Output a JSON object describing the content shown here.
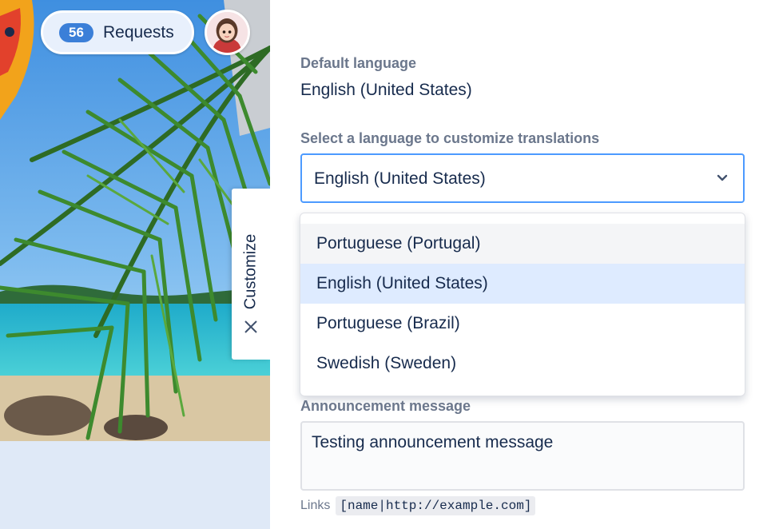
{
  "header": {
    "requests_count": "56",
    "requests_label": "Requests"
  },
  "customize_tab": {
    "label": "Customize",
    "close_icon": "close-icon"
  },
  "form": {
    "default_language_label": "Default language",
    "default_language_value": "English (United States)",
    "select_language_label": "Select a language to customize translations",
    "select_language_value": "English (United States)",
    "dropdown_options": [
      {
        "label": "Portuguese (Portugal)",
        "state": "hover"
      },
      {
        "label": "English (United States)",
        "state": "selected"
      },
      {
        "label": "Portuguese (Brazil)",
        "state": "normal"
      },
      {
        "label": "Swedish (Sweden)",
        "state": "normal"
      }
    ],
    "announcement_label": "Announcement message",
    "announcement_value": "Testing announcement message",
    "links_hint_label": "Links",
    "links_hint_code": "[name|http://example.com]"
  },
  "colors": {
    "accent": "#4c9aff",
    "badge": "#3b7fd8",
    "selected_option": "#deebff",
    "label_grey": "#6b778c"
  }
}
